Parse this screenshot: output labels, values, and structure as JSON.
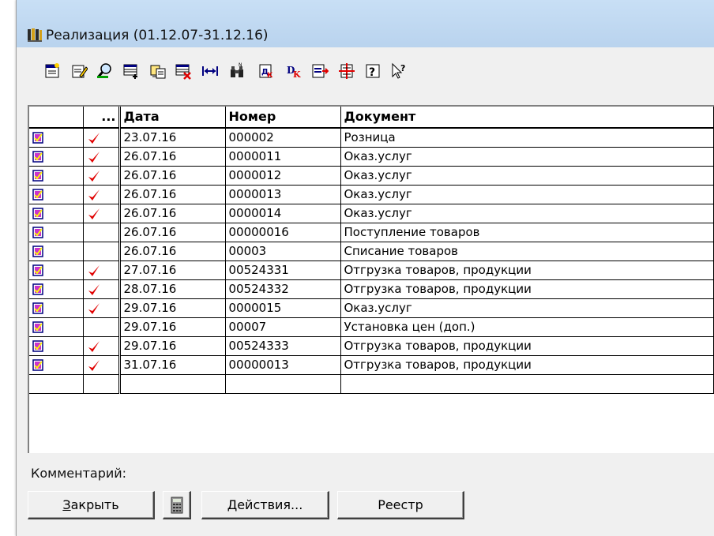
{
  "window": {
    "title": "Реализация (01.12.07-31.12.16)"
  },
  "toolbar": {
    "buttons": [
      {
        "icon": "new-document-icon"
      },
      {
        "icon": "edit-document-icon"
      },
      {
        "icon": "search-icon"
      },
      {
        "icon": "add-row-icon"
      },
      {
        "icon": "copy-document-icon"
      },
      {
        "icon": "delete-row-icon"
      },
      {
        "icon": "fit-width-icon"
      },
      {
        "icon": "binoculars-icon"
      },
      {
        "icon": "post-document-icon"
      },
      {
        "icon": "unpost-document-icon"
      },
      {
        "icon": "filter-icon"
      },
      {
        "icon": "structure-icon"
      },
      {
        "icon": "help-icon"
      },
      {
        "icon": "whats-this-icon"
      }
    ]
  },
  "grid": {
    "columns": [
      "",
      "...",
      "Дата",
      "Номер",
      "Документ"
    ],
    "rows": [
      {
        "posted": true,
        "date": "23.07.16",
        "number": "000002",
        "doc": "Розница"
      },
      {
        "posted": true,
        "date": "26.07.16",
        "number": "0000011",
        "doc": "Оказ.услуг"
      },
      {
        "posted": true,
        "date": "26.07.16",
        "number": "0000012",
        "doc": "Оказ.услуг"
      },
      {
        "posted": true,
        "date": "26.07.16",
        "number": "0000013",
        "doc": "Оказ.услуг"
      },
      {
        "posted": true,
        "date": "26.07.16",
        "number": "0000014",
        "doc": "Оказ.услуг"
      },
      {
        "posted": false,
        "date": "26.07.16",
        "number": "00000016",
        "doc": "Поступление товаров"
      },
      {
        "posted": false,
        "date": "26.07.16",
        "number": "00003",
        "doc": "Списание товаров"
      },
      {
        "posted": true,
        "date": "27.07.16",
        "number": "00524331",
        "doc": "Отгрузка товаров, продукции"
      },
      {
        "posted": true,
        "date": "28.07.16",
        "number": "00524332",
        "doc": "Отгрузка товаров, продукции"
      },
      {
        "posted": true,
        "date": "29.07.16",
        "number": "0000015",
        "doc": "Оказ.услуг"
      },
      {
        "posted": false,
        "date": "29.07.16",
        "number": "00007",
        "doc": "Установка цен (доп.)"
      },
      {
        "posted": true,
        "date": "29.07.16",
        "number": "00524333",
        "doc": "Отгрузка товаров, продукции"
      },
      {
        "posted": true,
        "date": "31.07.16",
        "number": "00000013",
        "doc": "Отгрузка товаров, продукции"
      }
    ]
  },
  "footer": {
    "comment_label": "Комментарий:",
    "close_hotkey": "З",
    "close_rest": "акрыть",
    "actions_label": "Действия...",
    "registry_label": "Реестр"
  },
  "colors": {
    "check": "#e00000",
    "doc_icon_fill": "#cc33cc",
    "titlebar": "#c3dbf3"
  }
}
